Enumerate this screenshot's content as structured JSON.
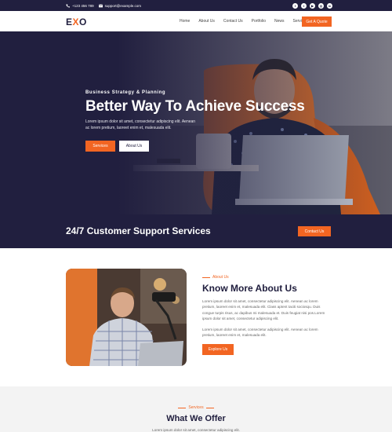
{
  "topbar": {
    "phone": "+123 456 789",
    "email": "support@example.com",
    "socials": [
      "facebook-icon",
      "twitter-icon",
      "youtube-icon",
      "instagram-icon",
      "linkedin-icon"
    ]
  },
  "nav": {
    "logo": {
      "part1": "E",
      "part2": "X",
      "part3": "O"
    },
    "items": [
      "Home",
      "About Us",
      "Contact Us",
      "Portfolio",
      "News",
      "Services"
    ],
    "quote_label": "Get A Quote"
  },
  "hero": {
    "kicker": "Business Strategy & Planning",
    "title": "Better Way To Achieve Success",
    "text": "Lorem ipsum dolor sit amet, consectetur adipiscing elit. Aenean ac lorem pretium, laoreet enim et, malesuada elit.",
    "primary_btn": "Services",
    "secondary_btn": "About Us"
  },
  "support": {
    "title": "24/7 Customer Support Services",
    "button": "Contact Us"
  },
  "about": {
    "tag": "About Us",
    "title": "Know More About Us",
    "para1": "Lorem ipsum dolor sit amet, consectetur adipiscing elit. Aenean ac lorem pretium, laoreet enim et, malesuada elit. Class aptent taciti sociosqu. Duis congue turpis risus, ac dapibus mi malesuada et. Duis feugiat nisi pos.Lorem ipsum dolor sit amet, consectetur adipiscing elit.",
    "para2": "Lorem ipsum dolor sit amet, consectetur adipiscing elit. Aenean ac lorem pretium, laoreet enim et, malesuada elit.",
    "button": "Explore Us"
  },
  "services": {
    "tag": "Services",
    "title": "What We Offer",
    "text": "Lorem ipsum dolor sit amet, consectetur adipiscing elit."
  },
  "colors": {
    "navy": "#211f3f",
    "orange": "#f26522"
  }
}
